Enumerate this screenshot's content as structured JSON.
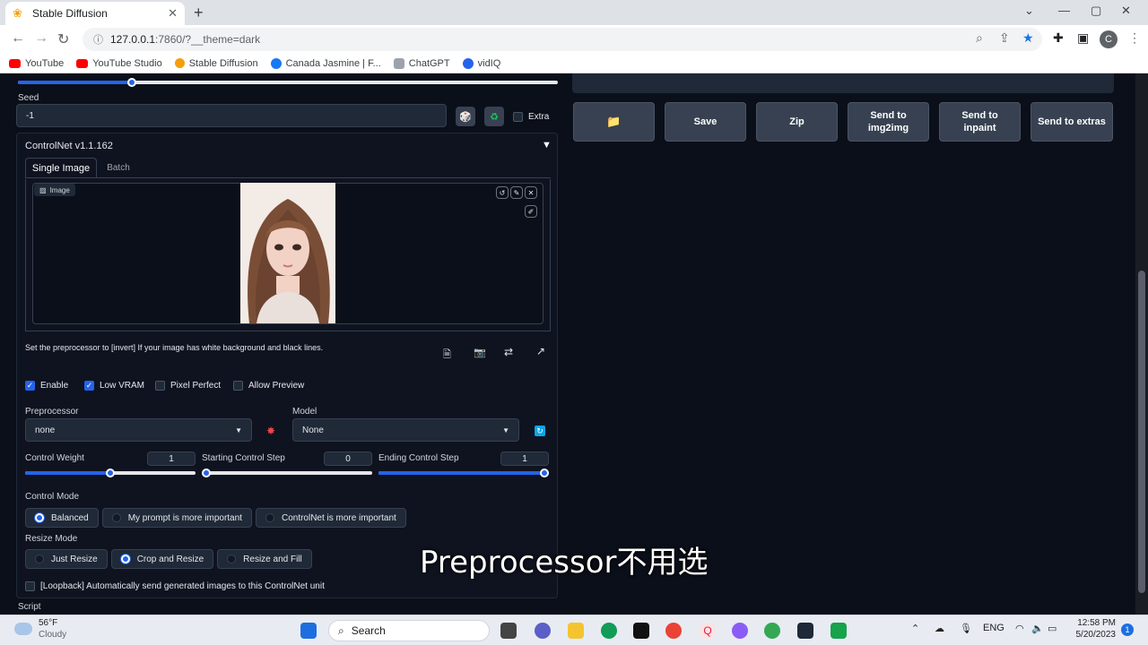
{
  "browser": {
    "tab_title": "Stable Diffusion",
    "url_host": "127.0.0.1",
    "url_rest": ":7860/?__theme=dark",
    "avatar_letter": "C",
    "bookmarks": [
      {
        "label": "YouTube",
        "color": "#ff0000"
      },
      {
        "label": "YouTube Studio",
        "color": "#ff0000"
      },
      {
        "label": "Stable Diffusion",
        "color": "#f59e0b"
      },
      {
        "label": "Canada Jasmine | F...",
        "color": "#1877f2"
      },
      {
        "label": "ChatGPT",
        "color": "#9ca3af"
      },
      {
        "label": "vidIQ",
        "color": "#2563eb"
      }
    ]
  },
  "seed": {
    "label": "Seed",
    "value": "-1",
    "extra_label": "Extra"
  },
  "controlnet": {
    "title": "ControlNet v1.1.162",
    "tabs": [
      "Single Image",
      "Batch"
    ],
    "image_label": "Image",
    "hint": "Set the preprocessor to [invert] If your image has white background and black lines.",
    "checks": [
      {
        "label": "Enable",
        "checked": true
      },
      {
        "label": "Low VRAM",
        "checked": true
      },
      {
        "label": "Pixel Perfect",
        "checked": false
      },
      {
        "label": "Allow Preview",
        "checked": false
      }
    ],
    "preprocessor_label": "Preprocessor",
    "preprocessor_value": "none",
    "model_label": "Model",
    "model_value": "None",
    "control_weight_label": "Control Weight",
    "control_weight_value": "1",
    "control_weight_fraction": 0.5,
    "start_step_label": "Starting Control Step",
    "start_step_value": "0",
    "start_step_fraction": 0.0,
    "end_step_label": "Ending Control Step",
    "end_step_value": "1",
    "end_step_fraction": 1.0,
    "control_mode_label": "Control Mode",
    "control_modes": [
      {
        "label": "Balanced",
        "selected": true
      },
      {
        "label": "My prompt is more important",
        "selected": false
      },
      {
        "label": "ControlNet is more important",
        "selected": false
      }
    ],
    "resize_mode_label": "Resize Mode",
    "resize_modes": [
      {
        "label": "Just Resize",
        "selected": false
      },
      {
        "label": "Crop and Resize",
        "selected": true
      },
      {
        "label": "Resize and Fill",
        "selected": false
      }
    ],
    "loopback_label": "[Loopback] Automatically send generated images to this ControlNet unit"
  },
  "script_label": "Script",
  "output_buttons": {
    "save": "Save",
    "zip": "Zip",
    "img2img": "Send to img2img",
    "inpaint": "Send to inpaint",
    "extras": "Send to extras"
  },
  "subtitle": "Preprocessor不用选",
  "taskbar": {
    "weather_temp": "56°F",
    "weather_desc": "Cloudy",
    "search_label": "Search",
    "lang": "ENG",
    "time": "12:58 PM",
    "date": "5/20/2023",
    "notification_count": "1"
  },
  "colors": {
    "accent": "#2563eb",
    "background": "#0b0f19",
    "button": "#374151"
  }
}
